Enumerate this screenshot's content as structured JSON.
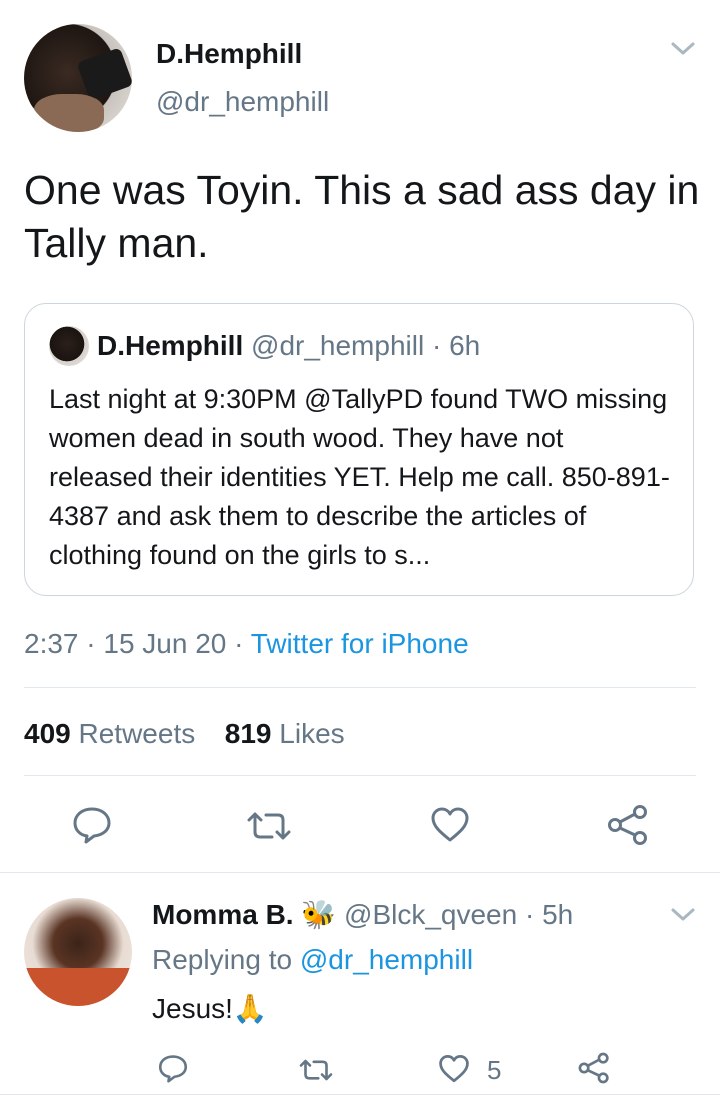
{
  "tweet": {
    "author_name": "D.Hemphill",
    "author_handle": "@dr_hemphill",
    "text": "One was Toyin. This a sad ass day in Tally man.",
    "quoted": {
      "author_name": "D.Hemphill",
      "author_handle": "@dr_hemphill",
      "time": "· 6h",
      "text": "Last night at 9:30PM @TallyPD found TWO missing women dead in south wood. They have not released their identities YET. Help me call. 850-891-4387 and ask them to describe the articles of clothing found on the girls to s..."
    },
    "timestamp": "2:37 · 15 Jun 20 ·",
    "source": "Twitter for iPhone",
    "retweets_count": "409",
    "retweets_label": "Retweets",
    "likes_count": "819",
    "likes_label": "Likes"
  },
  "reply": {
    "author_name": "Momma B.",
    "emoji": "🐝",
    "author_handle": "@Blck_qveen",
    "time": "· 5h",
    "replying_prefix": "Replying to",
    "replying_handle": "@dr_hemphill",
    "text": "Jesus!🙏",
    "like_count": "5"
  },
  "icons": {
    "action_icons": [
      "reply-icon",
      "retweet-icon",
      "like-icon",
      "share-icon"
    ],
    "menu_icon": "chevron-down-icon"
  },
  "colors": {
    "link": "#1b95e0",
    "muted": "#657786",
    "border": "#e1e8ed",
    "text": "#14171a"
  }
}
